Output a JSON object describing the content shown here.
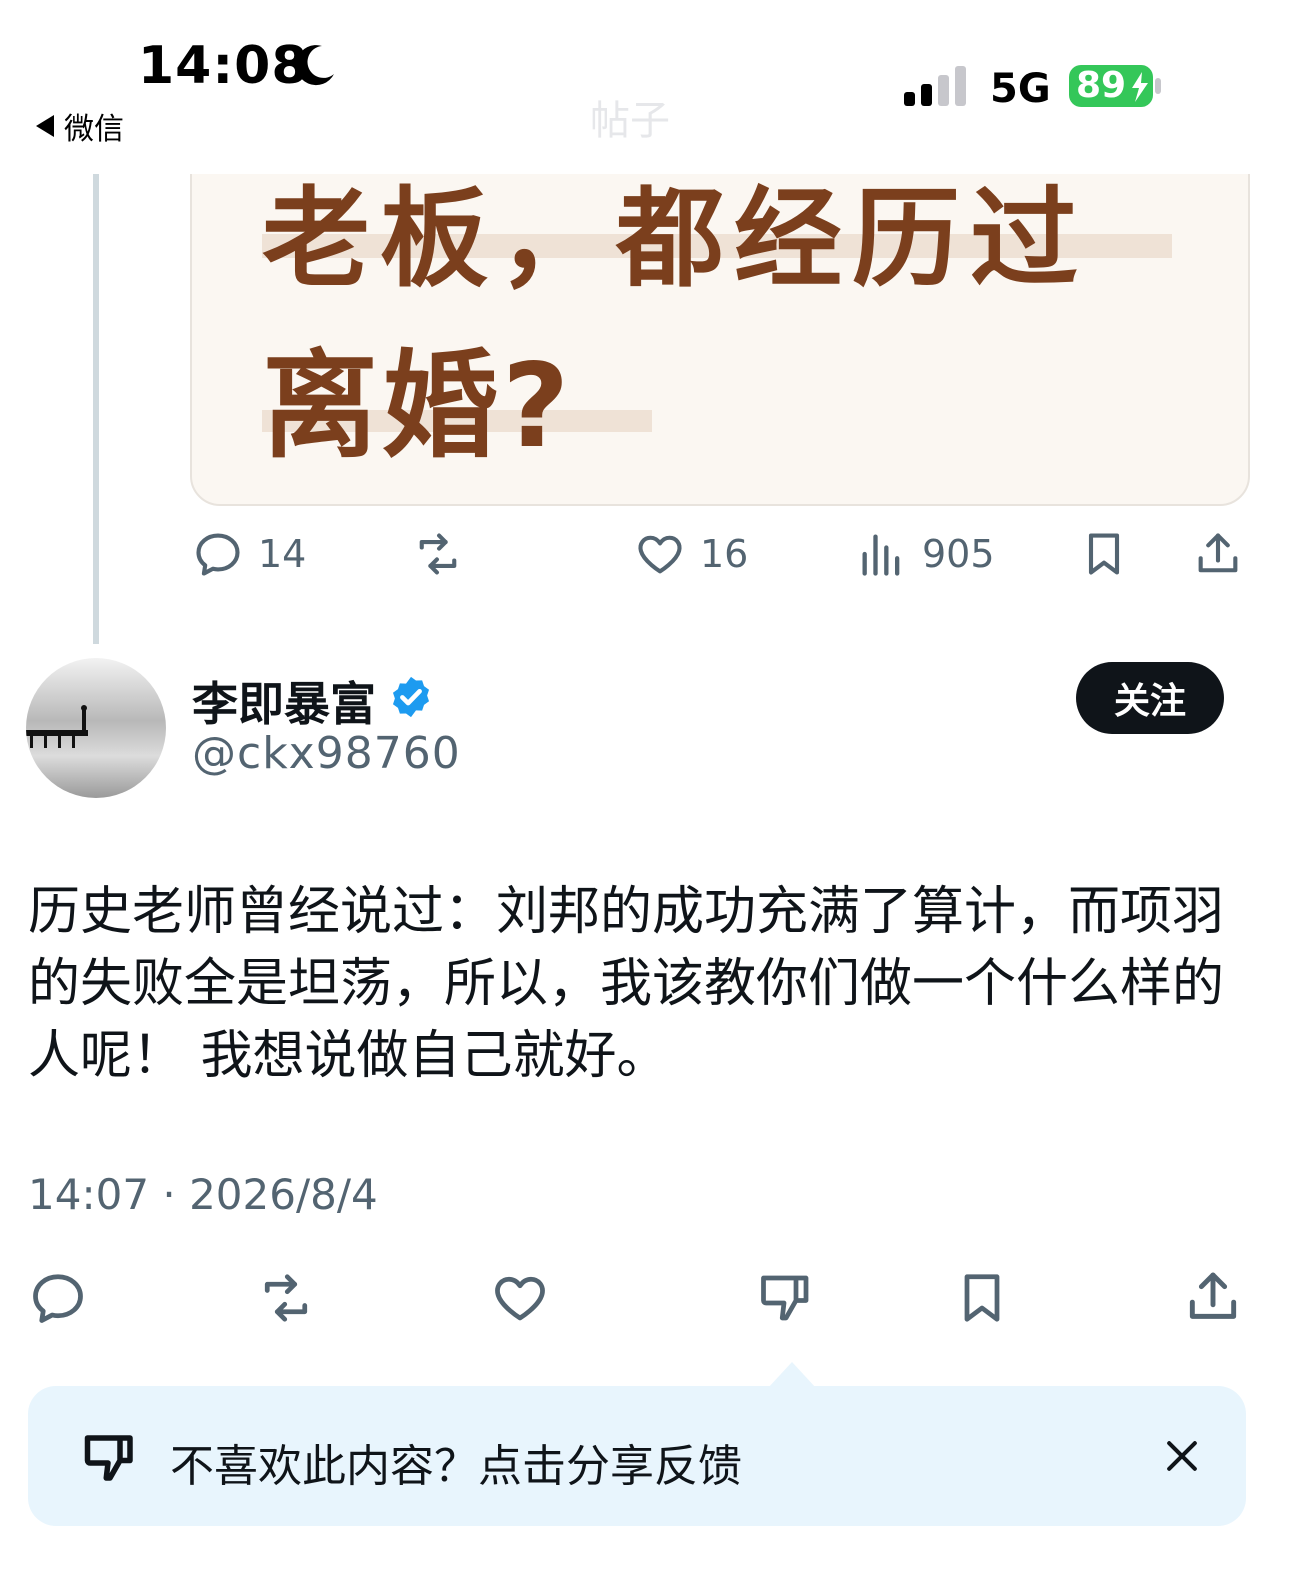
{
  "status_bar": {
    "time": "14:08",
    "network": "5G",
    "battery": "89",
    "back_label": "微信",
    "page_title": "帖子"
  },
  "quoted_post": {
    "image_text_line1": "老板，都经历过",
    "image_text_line2": "离婚?",
    "stats": {
      "replies": "14",
      "likes": "16",
      "views": "905"
    }
  },
  "author": {
    "name": "李即暴富",
    "handle": "@ckx98760",
    "follow_label": "关注"
  },
  "post": {
    "text": "历史老师曾经说过：刘邦的成功充满了算计，而项羽的失败全是坦荡，所以，我该教你们做一个什么样的人呢！ 我想说做自己就好。",
    "timestamp": "14:07 · 2026/8/4"
  },
  "feedback_banner": {
    "text": "不喜欢此内容？点击分享反馈"
  },
  "colors": {
    "accent": "#1d9bf0",
    "text": "#0f1419",
    "muted": "#536471",
    "banner_bg": "#e8f5fd",
    "battery": "#34c759"
  }
}
